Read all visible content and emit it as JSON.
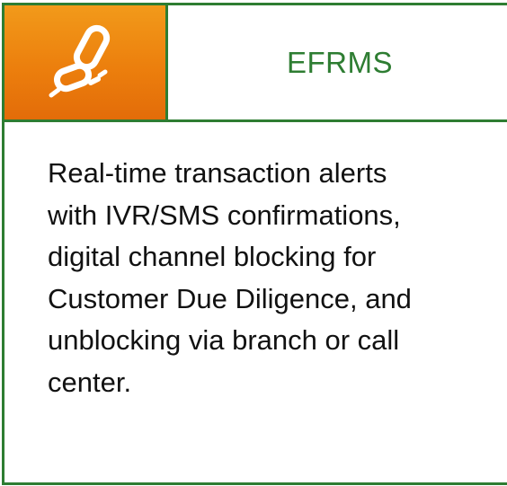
{
  "card": {
    "icon": "chain-link-icon",
    "title": "EFRMS",
    "description": "Real-time transaction alerts\nwith IVR/SMS confirmations,\ndigital channel blocking for\nCustomer Due Diligence, and\nunblocking via branch or call\ncenter."
  },
  "colors": {
    "border": "#2e7d32",
    "title": "#2e7d32",
    "icon_background": "#ec7f0d",
    "icon_glyph": "#ffffff",
    "text": "#111111"
  }
}
